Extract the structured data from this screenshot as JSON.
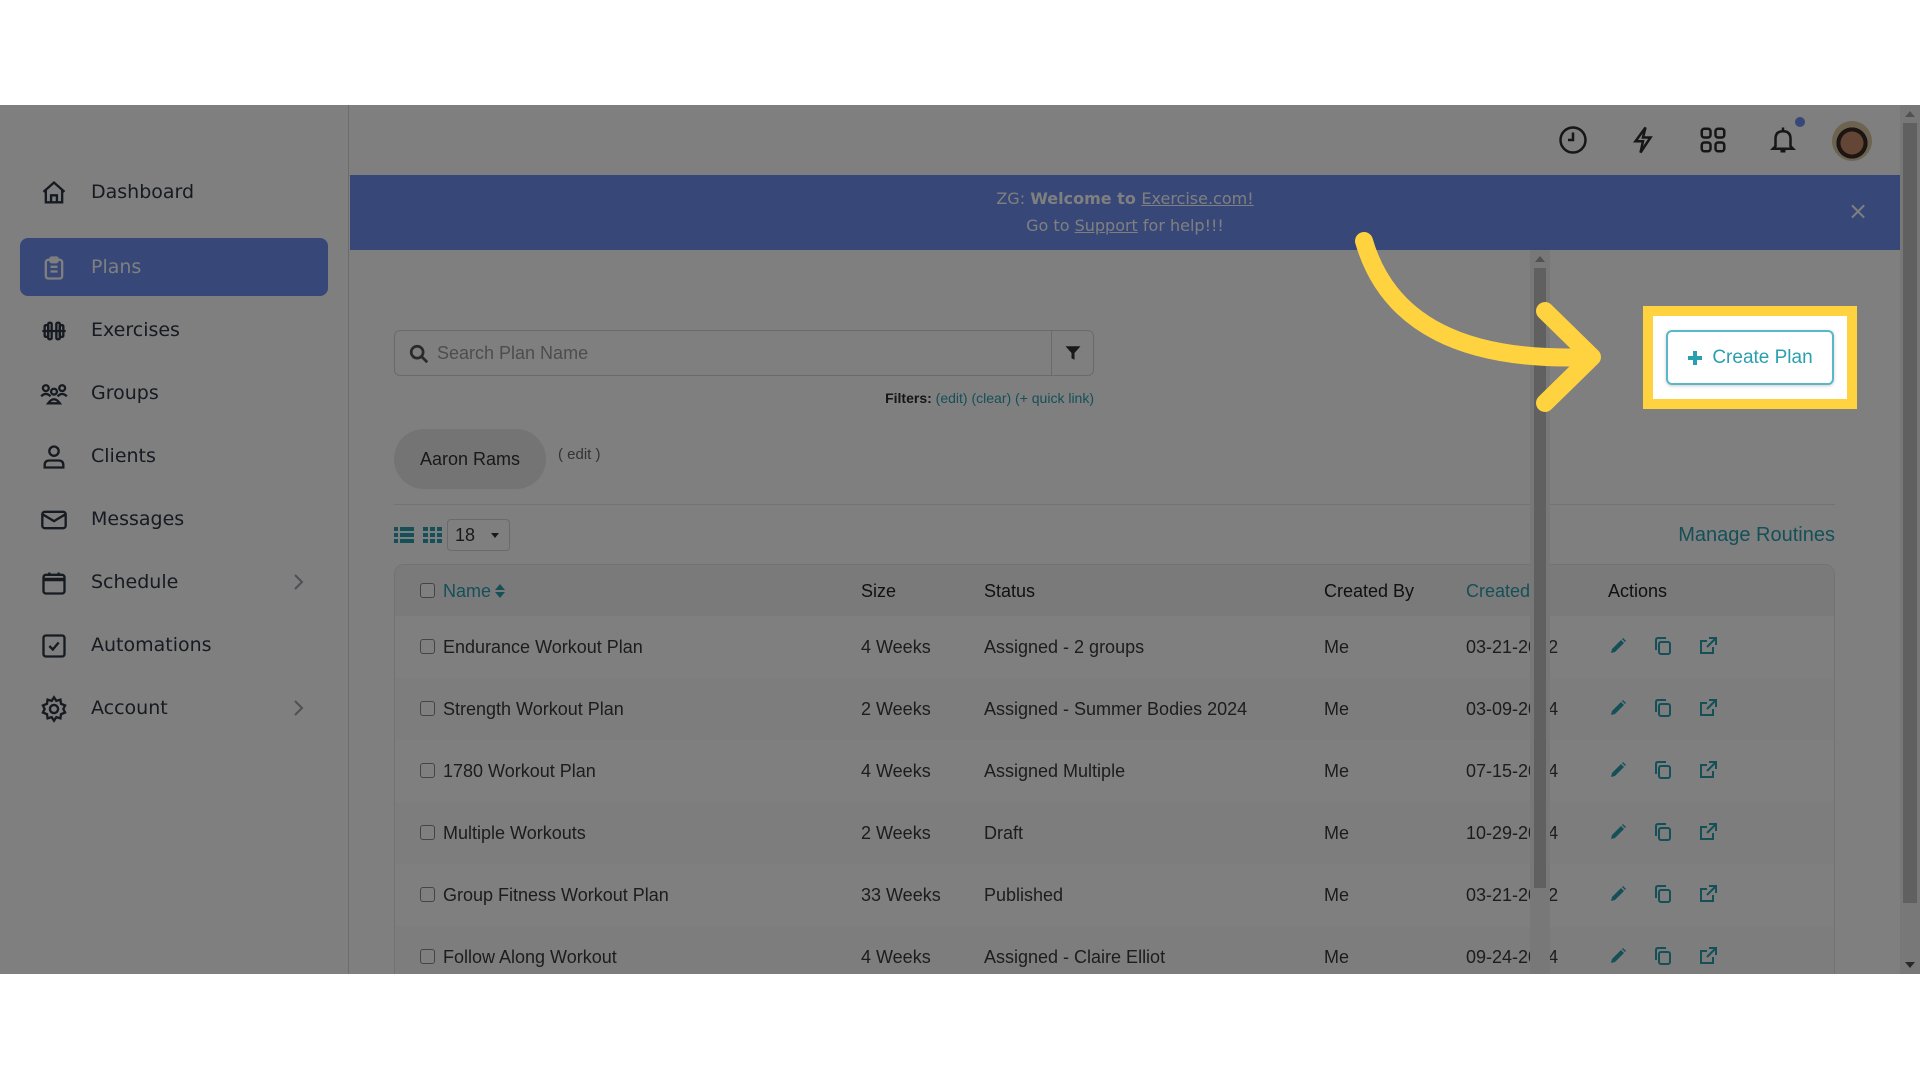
{
  "sidebar": {
    "items": [
      {
        "label": "Dashboard",
        "icon": "home-icon"
      },
      {
        "label": "Plans",
        "icon": "clipboard-icon",
        "active": true
      },
      {
        "label": "Exercises",
        "icon": "dumbbell-icon"
      },
      {
        "label": "Groups",
        "icon": "group-icon"
      },
      {
        "label": "Clients",
        "icon": "user-icon"
      },
      {
        "label": "Messages",
        "icon": "mail-icon"
      },
      {
        "label": "Schedule",
        "icon": "calendar-icon",
        "has_submenu": true
      },
      {
        "label": "Automations",
        "icon": "checkbox-icon"
      },
      {
        "label": "Account",
        "icon": "gear-icon",
        "has_submenu": true
      }
    ]
  },
  "topbar": {
    "icons": [
      "clock-icon",
      "lightning-icon",
      "apps-grid-icon",
      "bell-icon"
    ],
    "notification_dot_color": "#6f8ef0",
    "avatar": "user-avatar"
  },
  "banner": {
    "prefix": "ZG: ",
    "welcome": "Welcome to ",
    "site_link": "Exercise.com!",
    "goto": "Go to ",
    "support_link": "Support",
    "suffix": " for help!!!",
    "close": "×",
    "color": "#6f8ef0"
  },
  "search": {
    "placeholder": "Search Plan Name",
    "value": ""
  },
  "filters": {
    "label": "Filters:",
    "edit": "(edit)",
    "clear": "(clear)",
    "quick_link": "(+ quick link)"
  },
  "chip": {
    "label": "Aaron Rams",
    "edit": "( edit )"
  },
  "toolbar": {
    "per_page": "18",
    "manage_routines": "Manage Routines"
  },
  "create_plan": {
    "label": "Create Plan",
    "highlight_color": "#ffd23f"
  },
  "table": {
    "columns": [
      "Name",
      "Size",
      "Status",
      "Created By",
      "Created",
      "Actions"
    ],
    "rows": [
      {
        "name": "Endurance Workout Plan",
        "size": "4 Weeks",
        "status": "Assigned - 2 groups",
        "created_by": "Me",
        "created": "03-21-2022"
      },
      {
        "name": "Strength Workout Plan",
        "size": "2 Weeks",
        "status": "Assigned - Summer Bodies 2024",
        "created_by": "Me",
        "created": "03-09-2024"
      },
      {
        "name": "1780 Workout Plan",
        "size": "4 Weeks",
        "status": "Assigned Multiple",
        "created_by": "Me",
        "created": "07-15-2024"
      },
      {
        "name": "Multiple Workouts",
        "size": "2 Weeks",
        "status": "Draft",
        "created_by": "Me",
        "created": "10-29-2024"
      },
      {
        "name": "Group Fitness Workout Plan",
        "size": "33 Weeks",
        "status": "Published",
        "created_by": "Me",
        "created": "03-21-2022"
      },
      {
        "name": "Follow Along Workout",
        "size": "4 Weeks",
        "status": "Assigned - Claire Elliot",
        "created_by": "Me",
        "created": "09-24-2024"
      }
    ],
    "actions": [
      "edit-icon",
      "duplicate-icon",
      "external-link-icon"
    ]
  }
}
